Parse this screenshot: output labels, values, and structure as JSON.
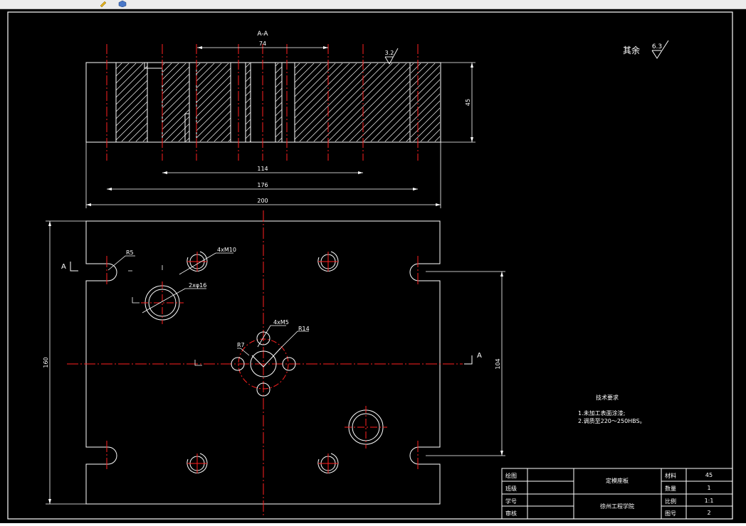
{
  "toolbar": {
    "icons": [
      "edit-icon",
      "cube-icon"
    ]
  },
  "section_view": {
    "label": "A-A"
  },
  "dimensions": {
    "d74": "74",
    "d45": "45",
    "d114": "114",
    "d176": "176",
    "d200": "200",
    "d160": "160",
    "d104": "104"
  },
  "surface_finish": {
    "local_value": "3.2",
    "note_text": "其余",
    "note_value": "6.3"
  },
  "annotations": {
    "r5": "R5",
    "m10": "4xM10",
    "phi16": "2xφ16",
    "m5": "4xM5",
    "r14": "R14",
    "r7": "R7",
    "section_mark_left": "A",
    "section_mark_right": "A"
  },
  "tech_requirements": {
    "title": "技术要求",
    "items": [
      "1.未加工表面涂漆;",
      "2.调质至220～250HBS。"
    ]
  },
  "title_block": {
    "rows": [
      {
        "label": "绘图",
        "value": ""
      },
      {
        "label": "班级",
        "value": ""
      },
      {
        "label": "学号",
        "value": ""
      },
      {
        "label": "审核",
        "value": ""
      }
    ],
    "part_name": "定模座板",
    "school": "徐州工程学院",
    "props": [
      {
        "label": "材料",
        "value": "45"
      },
      {
        "label": "数量",
        "value": "1"
      },
      {
        "label": "比例",
        "value": "1:1"
      },
      {
        "label": "图号",
        "value": "2"
      }
    ]
  },
  "colors": {
    "background": "#000000",
    "outline": "#ffffff",
    "centerline": "#ff2020"
  }
}
